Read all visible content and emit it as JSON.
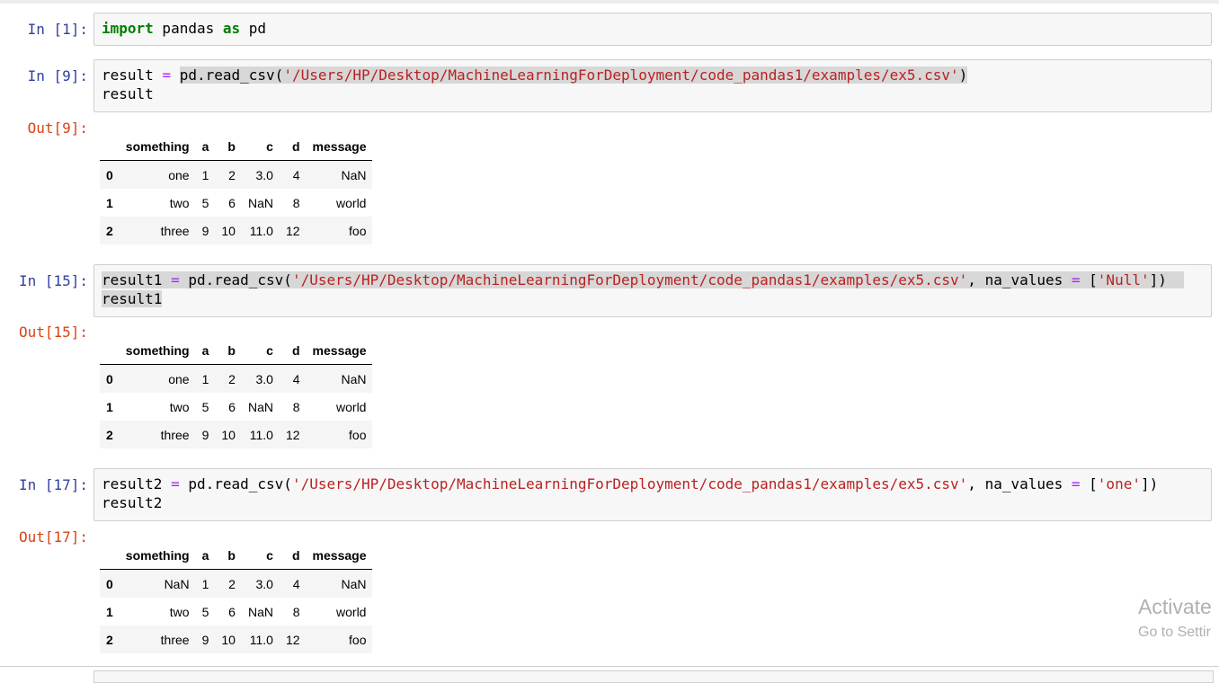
{
  "cells": [
    {
      "prompt": "In [1]:",
      "code_parts": [
        "import",
        " pandas ",
        "as",
        " pd"
      ]
    },
    {
      "prompt": "In [9]:",
      "code_line1": [
        "result ",
        "=",
        " ",
        "pd.read_csv(",
        "'/Users/HP/Desktop/MachineLearningForDeployment/code_pandas1/examples/ex5.csv'",
        ")"
      ],
      "code_line2": "result",
      "out_prompt": "Out[9]:"
    },
    {
      "prompt": "In [15]:",
      "code_line1": [
        "result1 ",
        "=",
        " pd.read_csv(",
        "'/Users/HP/Desktop/MachineLearningForDeployment/code_pandas1/examples/ex5.csv'",
        ", na_values ",
        "=",
        " [",
        "'Null'",
        "])"
      ],
      "code_line2": "result1",
      "out_prompt": "Out[15]:"
    },
    {
      "prompt": "In [17]:",
      "code_line1": [
        "result2 ",
        "=",
        " pd.read_csv(",
        "'/Users/HP/Desktop/MachineLearningForDeployment/code_pandas1/examples/ex5.csv'",
        ", na_values ",
        "=",
        " [",
        "'one'",
        "])"
      ],
      "code_line2": "result2",
      "out_prompt": "Out[17]:"
    }
  ],
  "table_headers": [
    "",
    "something",
    "a",
    "b",
    "c",
    "d",
    "message"
  ],
  "tables": [
    [
      [
        "0",
        "one",
        "1",
        "2",
        "3.0",
        "4",
        "NaN"
      ],
      [
        "1",
        "two",
        "5",
        "6",
        "NaN",
        "8",
        "world"
      ],
      [
        "2",
        "three",
        "9",
        "10",
        "11.0",
        "12",
        "foo"
      ]
    ],
    [
      [
        "0",
        "one",
        "1",
        "2",
        "3.0",
        "4",
        "NaN"
      ],
      [
        "1",
        "two",
        "5",
        "6",
        "NaN",
        "8",
        "world"
      ],
      [
        "2",
        "three",
        "9",
        "10",
        "11.0",
        "12",
        "foo"
      ]
    ],
    [
      [
        "0",
        "NaN",
        "1",
        "2",
        "3.0",
        "4",
        "NaN"
      ],
      [
        "1",
        "two",
        "5",
        "6",
        "NaN",
        "8",
        "world"
      ],
      [
        "2",
        "three",
        "9",
        "10",
        "11.0",
        "12",
        "foo"
      ]
    ]
  ],
  "watermark": {
    "line1": "Activate",
    "line2": "Go to Settir"
  }
}
